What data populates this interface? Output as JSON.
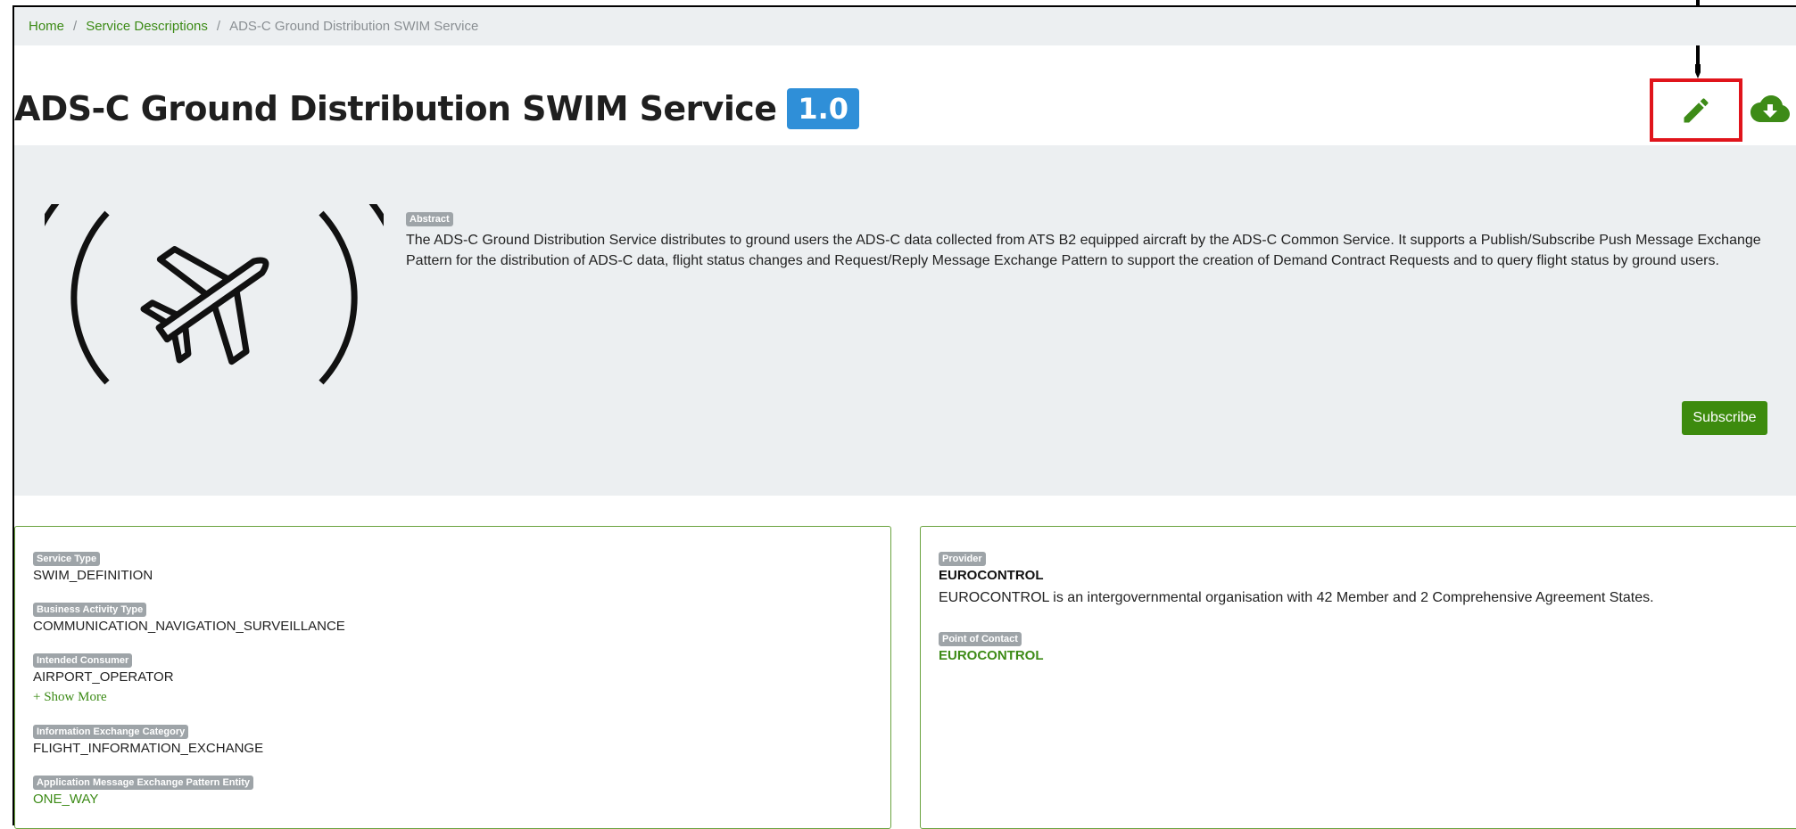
{
  "breadcrumb": {
    "items": [
      "Home",
      "Service Descriptions"
    ],
    "current": "ADS-C Ground Distribution SWIM Service",
    "separator": "/"
  },
  "header": {
    "title": "ADS-C Ground Distribution SWIM Service",
    "version": "1.0",
    "edit_icon": "pencil-icon",
    "download_icon": "cloud-download-icon"
  },
  "hero": {
    "image_icon": "airplane-signal-icon",
    "abstract_label": "Abstract",
    "abstract_text": "The ADS-C Ground Distribution Service distributes to ground users the ADS-C data collected from ATS B2 equipped aircraft by the ADS-C Common Service. It supports a Publish/Subscribe Push Message Exchange Pattern for the distribution of ADS-C data, flight status changes and Request/Reply Message Exchange Pattern to support the creation of Demand Contract Requests and to query flight status by ground users.",
    "subscribe_label": "Subscribe"
  },
  "details": {
    "service_type": {
      "label": "Service Type",
      "value": "SWIM_DEFINITION"
    },
    "business_activity": {
      "label": "Business Activity Type",
      "value": "COMMUNICATION_NAVIGATION_SURVEILLANCE"
    },
    "intended_consumer": {
      "label": "Intended Consumer",
      "value": "AIRPORT_OPERATOR",
      "show_more": "+ Show More"
    },
    "info_exchange": {
      "label": "Information Exchange Category",
      "value": "FLIGHT_INFORMATION_EXCHANGE"
    },
    "app_pattern": {
      "label": "Application Message Exchange Pattern Entity",
      "value": "ONE_WAY"
    }
  },
  "provider": {
    "label": "Provider",
    "name": "EUROCONTROL",
    "description": "EUROCONTROL is an intergovernmental organisation with 42 Member and 2 Comprehensive Agreement States.",
    "poc_label": "Point of Contact",
    "poc_name": "EUROCONTROL"
  },
  "colors": {
    "accent_green": "#3d8b17",
    "badge_blue": "#2f8fd8",
    "highlight_red": "#e0141b",
    "panel_gray": "#eceff1"
  }
}
